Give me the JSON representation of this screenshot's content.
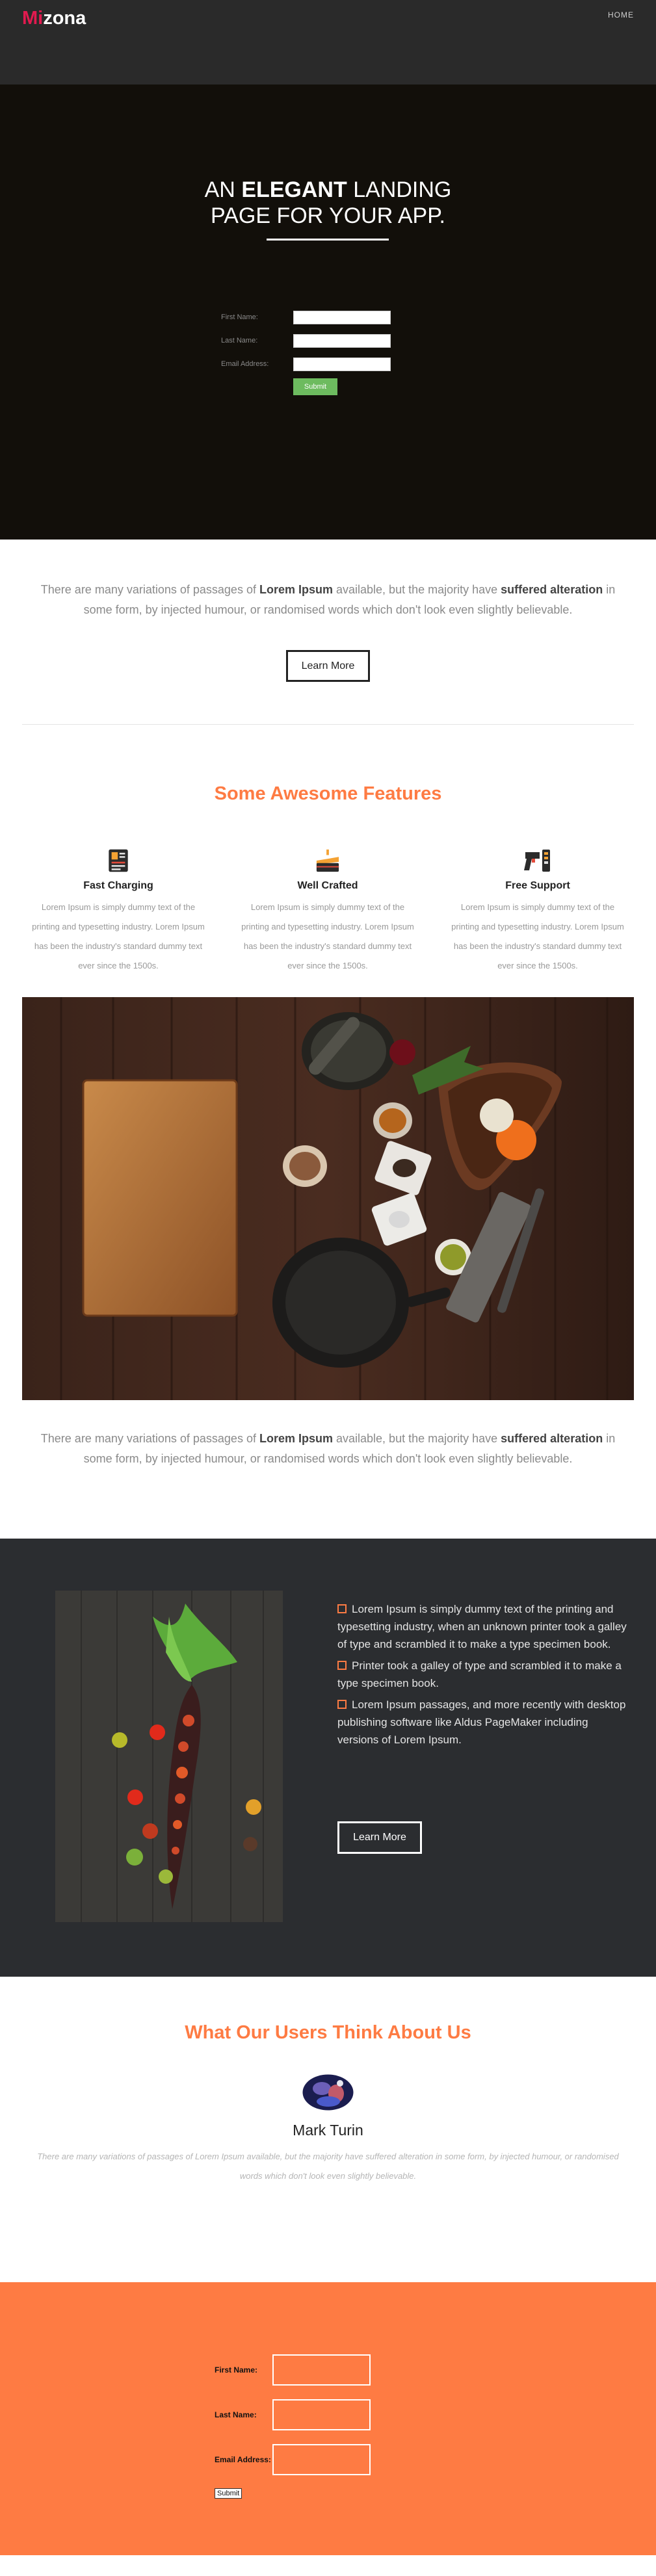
{
  "nav": {
    "logo_mark": "Mi",
    "logo_rest": "zona",
    "home_label": "HOME"
  },
  "hero": {
    "title_pre": "AN ",
    "title_bold": "ELEGANT",
    "title_post": " LANDING",
    "title_line2": "PAGE FOR YOUR APP.",
    "form": {
      "first_label": "First Name:",
      "last_label": "Last Name:",
      "email_label": "Email Address:",
      "submit_label": "Submit"
    }
  },
  "intro": {
    "t1": "There are many variations of passages of ",
    "b1": "Lorem Ipsum",
    "t2": " available, but the majority have ",
    "b2": "suffered alteration",
    "t3": " in some form, by injected humour, or randomised words which don't look even slightly believable.",
    "button_label": "Learn More"
  },
  "features": {
    "heading": "Some Awesome Features",
    "items": [
      {
        "icon": "charging-icon",
        "title": "Fast Charging",
        "text": "Lorem Ipsum is simply dummy text of the printing and typesetting industry. Lorem Ipsum has been the industry's standard dummy text ever since the 1500s."
      },
      {
        "icon": "cake-icon",
        "title": "Well Crafted",
        "text": "Lorem Ipsum is simply dummy text of the printing and typesetting industry. Lorem Ipsum has been the industry's standard dummy text ever since the 1500s."
      },
      {
        "icon": "support-icon",
        "title": "Free Support",
        "text": "Lorem Ipsum is simply dummy text of the printing and typesetting industry. Lorem Ipsum has been the industry's standard dummy text ever since the 1500s."
      }
    ]
  },
  "intro2": {
    "t1": "There are many variations of passages of ",
    "b1": "Lorem Ipsum",
    "t2": " available, but the majority have ",
    "b2": "suffered alteration",
    "t3": " in some form, by injected humour, or randomised words which don't look even slightly believable."
  },
  "dark": {
    "items": [
      "Lorem Ipsum is simply dummy text of the printing and typesetting industry, when an unknown printer took a galley of type and scrambled it to make a type specimen book.",
      "Printer took a galley of type and scrambled it to make a type specimen book.",
      "Lorem Ipsum passages, and more recently with desktop publishing software like Aldus PageMaker including versions of Lorem Ipsum."
    ],
    "button_label": "Learn More"
  },
  "testimonial": {
    "heading": "What Our Users Think About Us",
    "name": "Mark Turin",
    "quote": "There are many variations of passages of Lorem Ipsum available, but the majority have suffered alteration in some form, by injected humour, or randomised words which don't look even slightly believable."
  },
  "signup": {
    "first_label": "First Name:",
    "last_label": "Last Name:",
    "email_label": "Email Address:",
    "submit_label": "Submit"
  },
  "colors": {
    "accent": "#fe7b43",
    "logo": "#e21a4f",
    "dark": "#2b2d30",
    "submit_green": "#6dbb5f"
  }
}
